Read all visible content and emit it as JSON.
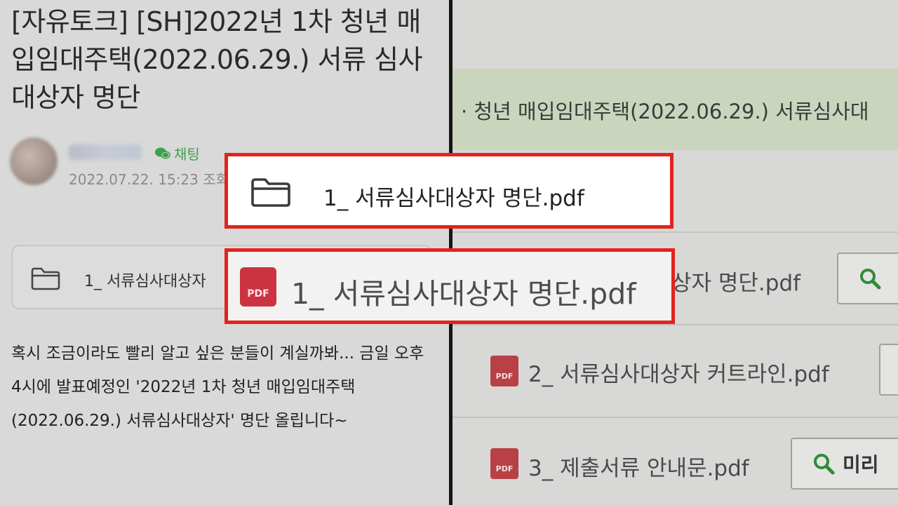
{
  "post": {
    "title": "[자유토크] [SH]2022년 1차 청년 매입임대주택(2022.06.29.) 서류 심사대상자 명단",
    "chat_tag": "채팅",
    "meta": "2022.07.22. 15:23  조회",
    "attachment": "1_ 서류심사대상자",
    "body": "혹시 조금이라도 빨리 알고 싶은 분들이 계실까봐... 금일 오후 4시에 발표예정인 '2022년 1차 청년 매입임대주택(2022.06.29.) 서류심사대상자' 명단 올립니다~"
  },
  "right_panel": {
    "title": "· 청년 매입임대주택(2022.06.29.) 서류심사대",
    "files": [
      {
        "label": "상자 명단.pdf",
        "icon": "pdf-icon"
      },
      {
        "label": "2_ 서류심사대상자 커트라인.pdf",
        "icon": "pdf-icon"
      },
      {
        "label": "3_ 제출서류 안내문.pdf",
        "icon": "pdf-icon"
      }
    ],
    "preview_button": "미리"
  },
  "highlight": {
    "folder_file": "1_ 서류심사대상자 명단.pdf",
    "pdf_file": "1_ 서류심사대상자 명단.pdf",
    "pdf_icon_text": "PDF"
  },
  "colors": {
    "highlight_border": "#e3231c",
    "chat_green": "#3fa04a",
    "pdf_red": "#cc3340"
  }
}
